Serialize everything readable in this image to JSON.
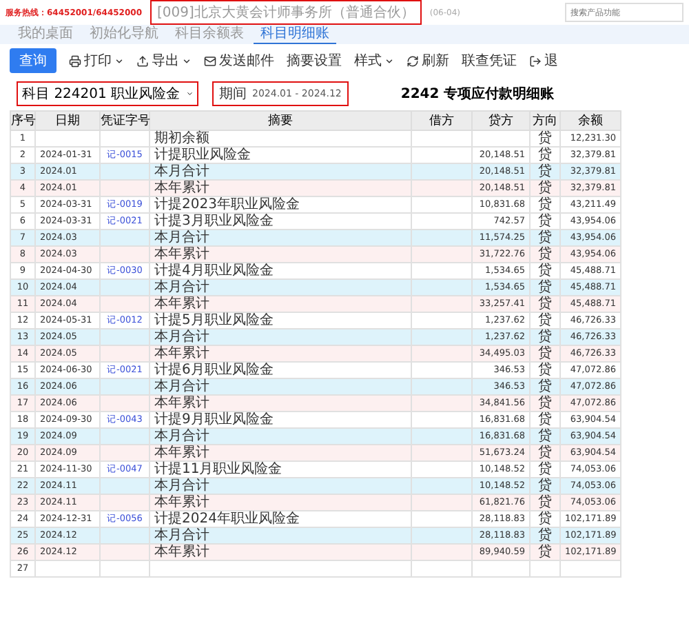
{
  "header": {
    "hotline": "服务热线：64452001/64452000",
    "company": "[009]北京大黄会计师事务所（普通合伙）",
    "date_suffix": "(06-04)",
    "search": {
      "placeholder": "搜索产品功能"
    }
  },
  "tabs": [
    {
      "label": "我的桌面",
      "selected": false
    },
    {
      "label": "初始化导航",
      "selected": false
    },
    {
      "label": "科目余额表",
      "selected": false
    },
    {
      "label": "科目明细账",
      "selected": true
    }
  ],
  "toolbar": [
    {
      "label": "查询",
      "kind": "primary"
    },
    {
      "label": "打印",
      "kind": "print",
      "menu": true
    },
    {
      "label": "导出",
      "kind": "export",
      "menu": true
    },
    {
      "label": "发送邮件",
      "kind": "mail",
      "menu": false
    },
    {
      "label": "摘要设置",
      "kind": "plain",
      "menu": false
    },
    {
      "label": "样式",
      "kind": "plain",
      "menu": true
    },
    {
      "label": "刷新",
      "kind": "refresh",
      "menu": false
    },
    {
      "label": "联查凭证",
      "kind": "plain",
      "menu": false
    },
    {
      "label": "退",
      "kind": "exit",
      "menu": false
    }
  ],
  "filter": {
    "subject_label": "科目",
    "subject_value": "224201 职业风险金",
    "period_label": "期间",
    "period_value": "2024.01 - 2024.12"
  },
  "title": "2242 专项应付款明细账",
  "table": {
    "columns": [
      "序号",
      "日期",
      "凭证字号",
      "摘要",
      "借方",
      "贷方",
      "方向",
      "余额"
    ],
    "rows": [
      {
        "kind": "detail",
        "no": "1",
        "date": "",
        "voucher": "",
        "summary": "期初余额",
        "debit": "",
        "credit": "",
        "dir": "贷",
        "balance": "12,231.30"
      },
      {
        "kind": "detail",
        "no": "2",
        "date": "2024-01-31",
        "voucher": "记-0015",
        "summary": "计提职业风险金",
        "debit": "",
        "credit": "20,148.51",
        "dir": "贷",
        "balance": "32,379.81"
      },
      {
        "kind": "month",
        "no": "3",
        "date": "2024.01",
        "voucher": "",
        "summary": "本月合计",
        "debit": "",
        "credit": "20,148.51",
        "dir": "贷",
        "balance": "32,379.81"
      },
      {
        "kind": "year",
        "no": "4",
        "date": "2024.01",
        "voucher": "",
        "summary": "本年累计",
        "debit": "",
        "credit": "20,148.51",
        "dir": "贷",
        "balance": "32,379.81"
      },
      {
        "kind": "detail",
        "no": "5",
        "date": "2024-03-31",
        "voucher": "记-0019",
        "summary": "计提2023年职业风险金",
        "debit": "",
        "credit": "10,831.68",
        "dir": "贷",
        "balance": "43,211.49"
      },
      {
        "kind": "detail",
        "no": "6",
        "date": "2024-03-31",
        "voucher": "记-0021",
        "summary": "计提3月职业风险金",
        "debit": "",
        "credit": "742.57",
        "dir": "贷",
        "balance": "43,954.06"
      },
      {
        "kind": "month",
        "no": "7",
        "date": "2024.03",
        "voucher": "",
        "summary": "本月合计",
        "debit": "",
        "credit": "11,574.25",
        "dir": "贷",
        "balance": "43,954.06"
      },
      {
        "kind": "year",
        "no": "8",
        "date": "2024.03",
        "voucher": "",
        "summary": "本年累计",
        "debit": "",
        "credit": "31,722.76",
        "dir": "贷",
        "balance": "43,954.06"
      },
      {
        "kind": "detail",
        "no": "9",
        "date": "2024-04-30",
        "voucher": "记-0030",
        "summary": "计提4月职业风险金",
        "debit": "",
        "credit": "1,534.65",
        "dir": "贷",
        "balance": "45,488.71"
      },
      {
        "kind": "month",
        "no": "10",
        "date": "2024.04",
        "voucher": "",
        "summary": "本月合计",
        "debit": "",
        "credit": "1,534.65",
        "dir": "贷",
        "balance": "45,488.71"
      },
      {
        "kind": "year",
        "no": "11",
        "date": "2024.04",
        "voucher": "",
        "summary": "本年累计",
        "debit": "",
        "credit": "33,257.41",
        "dir": "贷",
        "balance": "45,488.71"
      },
      {
        "kind": "detail",
        "no": "12",
        "date": "2024-05-31",
        "voucher": "记-0012",
        "summary": "计提5月职业风险金",
        "debit": "",
        "credit": "1,237.62",
        "dir": "贷",
        "balance": "46,726.33"
      },
      {
        "kind": "month",
        "no": "13",
        "date": "2024.05",
        "voucher": "",
        "summary": "本月合计",
        "debit": "",
        "credit": "1,237.62",
        "dir": "贷",
        "balance": "46,726.33"
      },
      {
        "kind": "year",
        "no": "14",
        "date": "2024.05",
        "voucher": "",
        "summary": "本年累计",
        "debit": "",
        "credit": "34,495.03",
        "dir": "贷",
        "balance": "46,726.33"
      },
      {
        "kind": "detail",
        "no": "15",
        "date": "2024-06-30",
        "voucher": "记-0021",
        "summary": "计提6月职业风险金",
        "debit": "",
        "credit": "346.53",
        "dir": "贷",
        "balance": "47,072.86"
      },
      {
        "kind": "month",
        "no": "16",
        "date": "2024.06",
        "voucher": "",
        "summary": "本月合计",
        "debit": "",
        "credit": "346.53",
        "dir": "贷",
        "balance": "47,072.86"
      },
      {
        "kind": "year",
        "no": "17",
        "date": "2024.06",
        "voucher": "",
        "summary": "本年累计",
        "debit": "",
        "credit": "34,841.56",
        "dir": "贷",
        "balance": "47,072.86"
      },
      {
        "kind": "detail",
        "no": "18",
        "date": "2024-09-30",
        "voucher": "记-0043",
        "summary": "计提9月职业风险金",
        "debit": "",
        "credit": "16,831.68",
        "dir": "贷",
        "balance": "63,904.54"
      },
      {
        "kind": "month",
        "no": "19",
        "date": "2024.09",
        "voucher": "",
        "summary": "本月合计",
        "debit": "",
        "credit": "16,831.68",
        "dir": "贷",
        "balance": "63,904.54"
      },
      {
        "kind": "year",
        "no": "20",
        "date": "2024.09",
        "voucher": "",
        "summary": "本年累计",
        "debit": "",
        "credit": "51,673.24",
        "dir": "贷",
        "balance": "63,904.54"
      },
      {
        "kind": "detail",
        "no": "21",
        "date": "2024-11-30",
        "voucher": "记-0047",
        "summary": "计提11月职业风险金",
        "debit": "",
        "credit": "10,148.52",
        "dir": "贷",
        "balance": "74,053.06"
      },
      {
        "kind": "month",
        "no": "22",
        "date": "2024.11",
        "voucher": "",
        "summary": "本月合计",
        "debit": "",
        "credit": "10,148.52",
        "dir": "贷",
        "balance": "74,053.06"
      },
      {
        "kind": "year",
        "no": "23",
        "date": "2024.11",
        "voucher": "",
        "summary": "本年累计",
        "debit": "",
        "credit": "61,821.76",
        "dir": "贷",
        "balance": "74,053.06"
      },
      {
        "kind": "detail",
        "no": "24",
        "date": "2024-12-31",
        "voucher": "记-0056",
        "summary": "计提2024年职业风险金",
        "debit": "",
        "credit": "28,118.83",
        "dir": "贷",
        "balance": "102,171.89"
      },
      {
        "kind": "month",
        "no": "25",
        "date": "2024.12",
        "voucher": "",
        "summary": "本月合计",
        "debit": "",
        "credit": "28,118.83",
        "dir": "贷",
        "balance": "102,171.89"
      },
      {
        "kind": "year",
        "no": "26",
        "date": "2024.12",
        "voucher": "",
        "summary": "本年累计",
        "debit": "",
        "credit": "89,940.59",
        "dir": "贷",
        "balance": "102,171.89"
      },
      {
        "kind": "detail",
        "no": "27",
        "date": "",
        "voucher": "",
        "summary": "",
        "debit": "",
        "credit": "",
        "dir": "",
        "balance": ""
      }
    ]
  }
}
